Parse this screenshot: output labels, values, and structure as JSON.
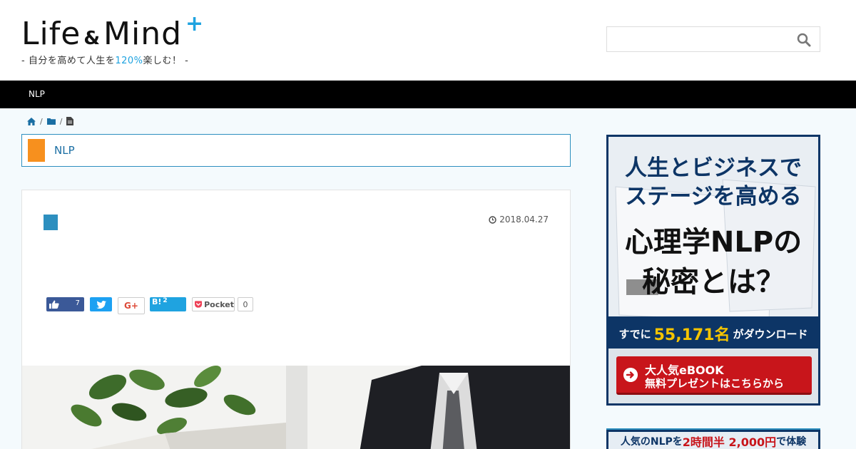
{
  "header": {
    "logo_part1": "Life",
    "logo_amp": "&",
    "logo_part2": "Mind",
    "logo_plus": "+",
    "tagline_before": "- 自分を高めて人生を",
    "tagline_pct": "120%",
    "tagline_after": "楽しむ！ -",
    "search_placeholder": ""
  },
  "nav": {
    "items": [
      {
        "label": "NLP"
      }
    ]
  },
  "breadcrumb": {
    "separator": "/"
  },
  "category": {
    "label": "NLP"
  },
  "article": {
    "date": "2018.04.27",
    "share": {
      "facebook_count": "7",
      "hatena_label": "B!",
      "hatena_count": "2",
      "google_label": "G+",
      "pocket_label": "Pocket",
      "pocket_count": "0"
    }
  },
  "sidebar_ad": {
    "line1": "人生とビジネスで",
    "line2": "ステージを高める",
    "line3": "心理学NLPの",
    "line4": "秘密とは？",
    "download_prefix": "すでに",
    "download_count": "55,171名",
    "download_suffix": "がダウンロード",
    "button_line1": "大人気eBOOK",
    "button_line2": "無料プレゼントはこちらから"
  },
  "sidebar_ad2": {
    "prefix": "人気のNLPを",
    "highlight": "2時間半 2,000円",
    "suffix": "で体験"
  },
  "colors": {
    "accent": "#1fa3e0",
    "category_mark": "#f7901e",
    "title_mark": "#2d8fbf",
    "ad_navy": "#0d3566",
    "ad_red": "#c8151b"
  }
}
